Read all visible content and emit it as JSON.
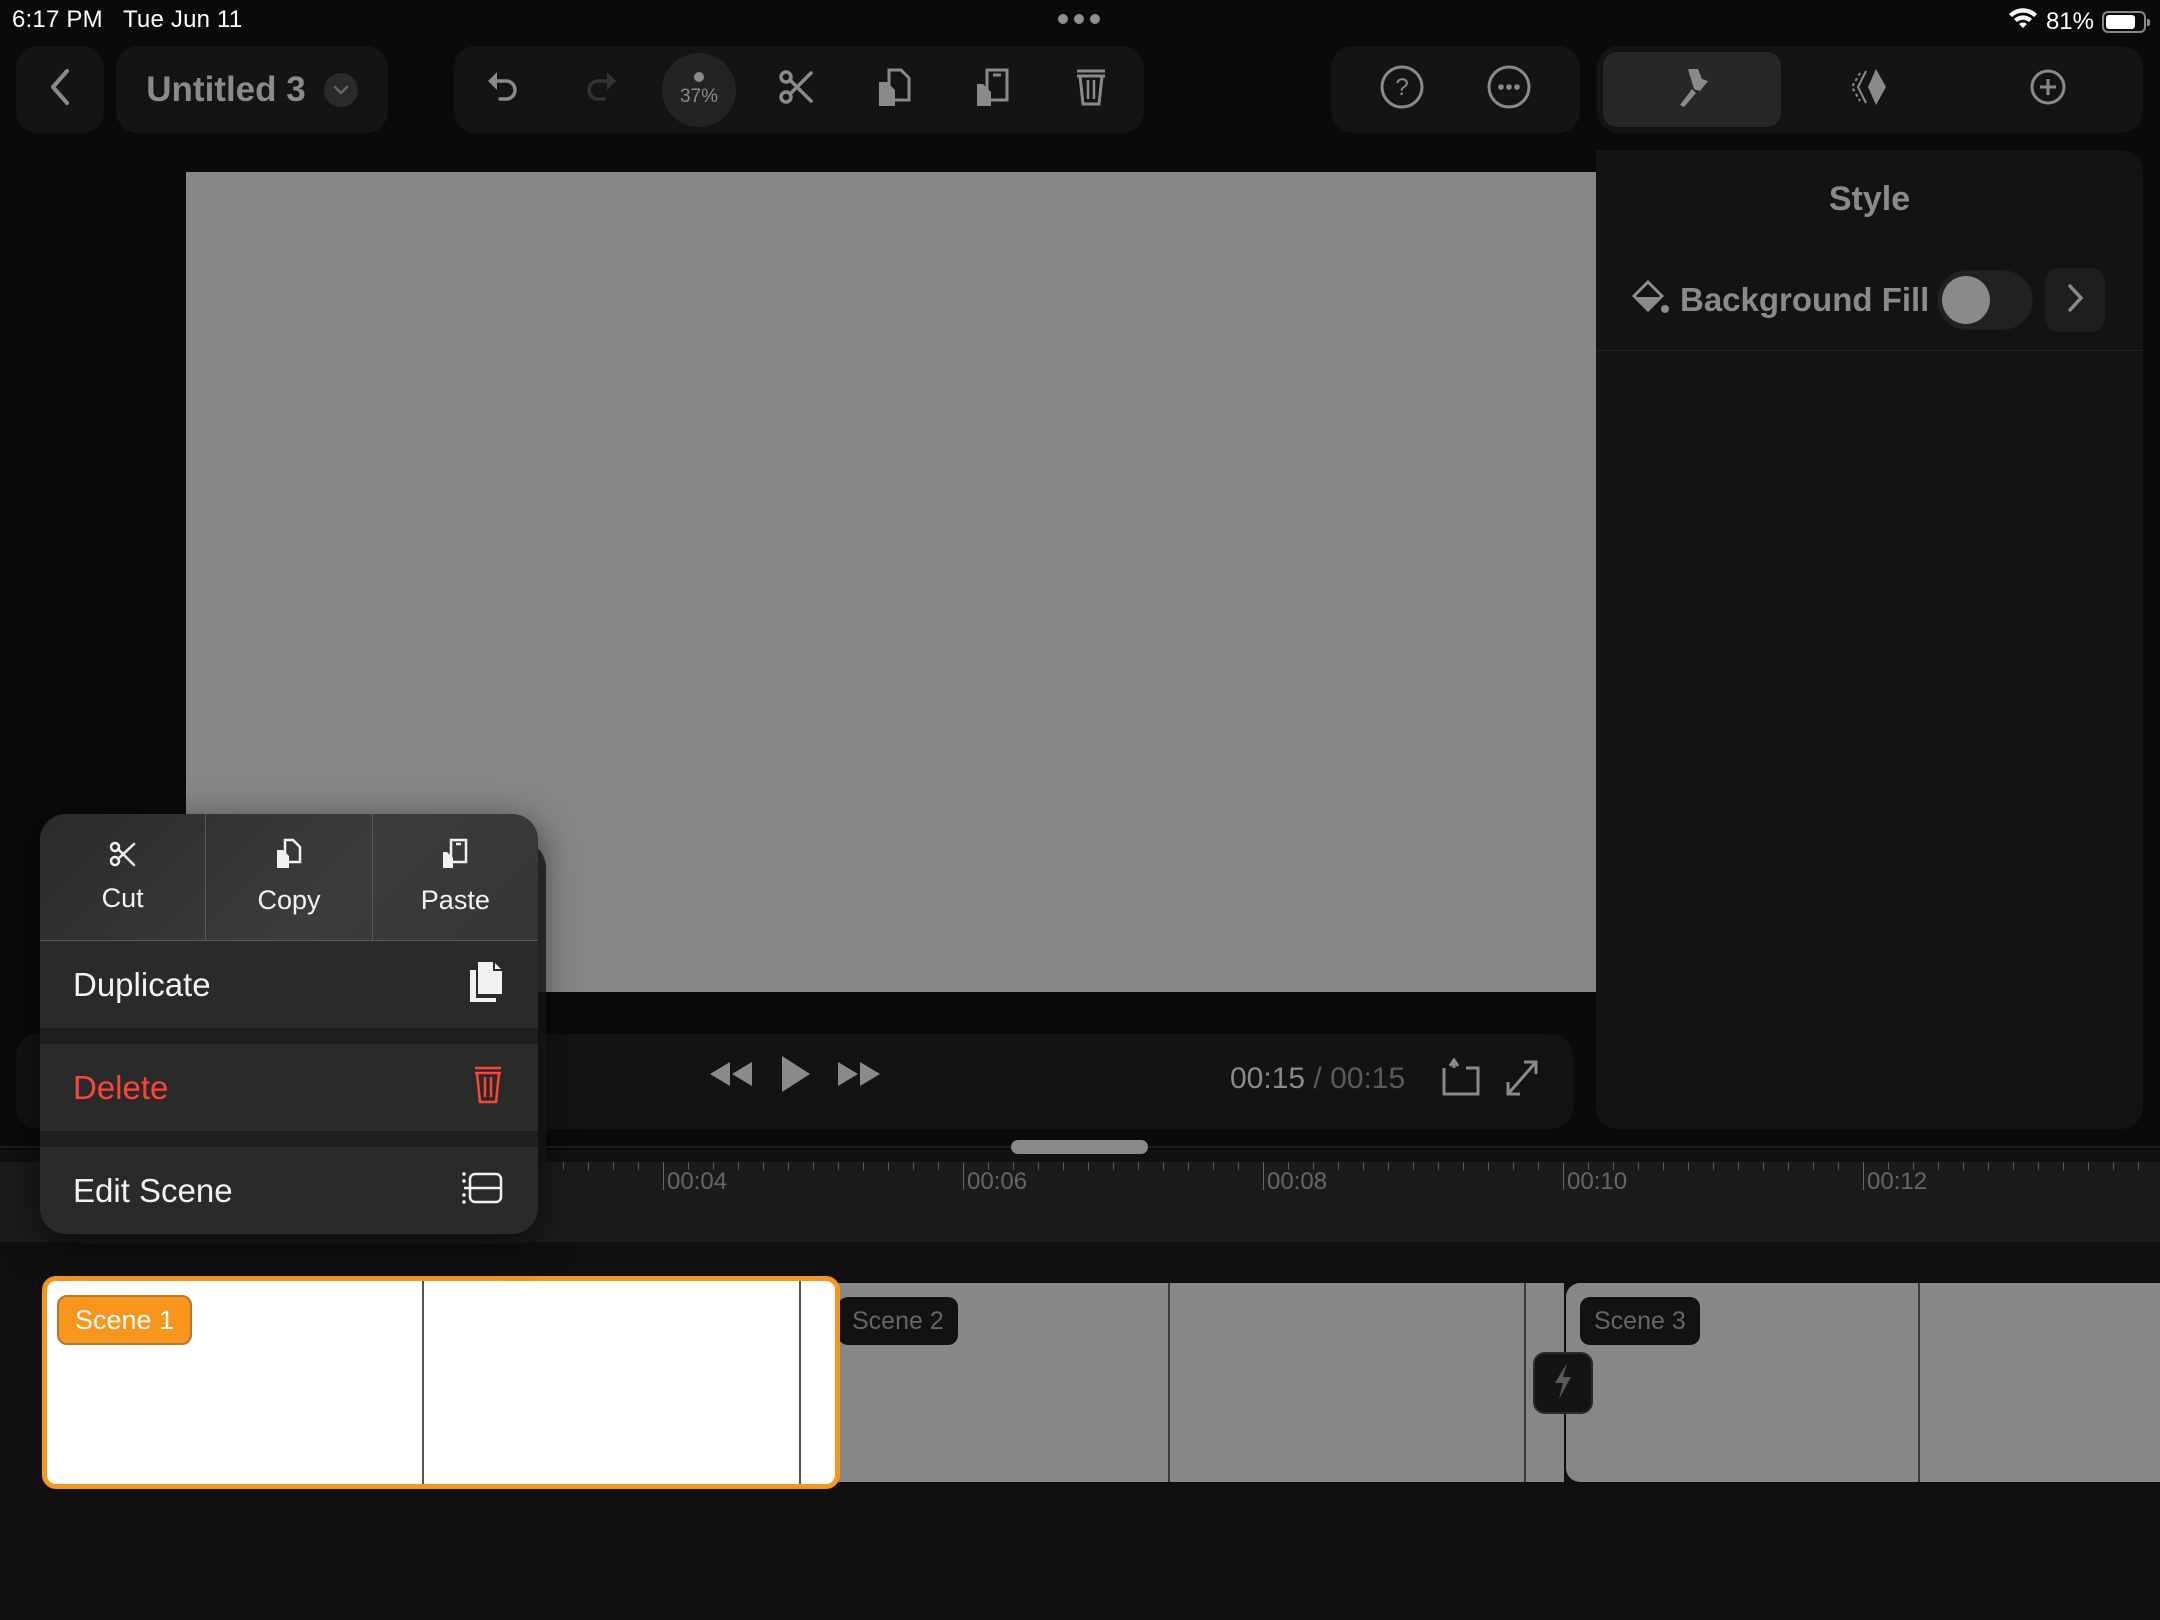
{
  "status_bar": {
    "time": "6:17 PM",
    "date": "Tue Jun 11",
    "battery_pct": "81%",
    "battery_level": 0.81,
    "wifi_icon": "wifi-icon"
  },
  "header": {
    "back_icon": "chevron-left-icon",
    "project_title": "Untitled 3",
    "title_menu_icon": "chevron-down-icon",
    "tools": [
      {
        "name": "undo",
        "icon": "undo-icon",
        "enabled": true
      },
      {
        "name": "redo",
        "icon": "redo-icon",
        "enabled": false
      },
      {
        "name": "zoom",
        "value": "37%"
      },
      {
        "name": "cut",
        "icon": "scissors-icon",
        "enabled": true
      },
      {
        "name": "copy",
        "icon": "copy-icon",
        "enabled": true
      },
      {
        "name": "paste",
        "icon": "paste-icon",
        "enabled": true
      },
      {
        "name": "delete",
        "icon": "trash-icon",
        "enabled": true
      }
    ],
    "zoom_level": "37%",
    "help_icon": "question-circle-icon",
    "more_icon": "ellipsis-circle-icon",
    "inspector_tabs": [
      {
        "name": "style",
        "icon": "paintbrush-icon",
        "active": true
      },
      {
        "name": "animation",
        "icon": "keyframe-icon",
        "active": false
      },
      {
        "name": "add",
        "icon": "plus-circle-icon",
        "active": false
      }
    ]
  },
  "inspector": {
    "title": "Style",
    "rows": [
      {
        "icon": "paint-bucket-icon",
        "label": "Background Fill",
        "toggle_on": false
      }
    ]
  },
  "playback": {
    "current_time": "00:15",
    "separator": " / ",
    "total_time": "00:15",
    "rewind_icon": "rewind-icon",
    "play_icon": "play-icon",
    "fast_forward_icon": "fast-forward-icon",
    "loop_icon": "loop-icon",
    "fullscreen_icon": "fullscreen-icon"
  },
  "ruler": {
    "labels": [
      "00:04",
      "00:06",
      "00:08",
      "00:10",
      "00:12"
    ]
  },
  "timeline": {
    "scenes": [
      {
        "label": "Scene 1",
        "selected": true
      },
      {
        "label": "Scene 2",
        "selected": false
      },
      {
        "label": "Scene 3",
        "selected": false
      }
    ],
    "transition_icon": "lightning-icon"
  },
  "context_menu": {
    "quick_actions": [
      {
        "label": "Cut",
        "icon": "scissors-icon"
      },
      {
        "label": "Copy",
        "icon": "copy-icon"
      },
      {
        "label": "Paste",
        "icon": "paste-icon"
      }
    ],
    "items": [
      {
        "label": "Duplicate",
        "icon": "duplicate-icon",
        "destructive": false
      },
      {
        "label": "Delete",
        "icon": "trash-icon",
        "destructive": true
      },
      {
        "label": "Edit Scene",
        "icon": "edit-scene-icon",
        "destructive": false
      }
    ]
  },
  "colors": {
    "accent": "#f7951d",
    "destructive": "#ff453a",
    "canvas": "#878787",
    "icon": "#8a8a8a"
  }
}
